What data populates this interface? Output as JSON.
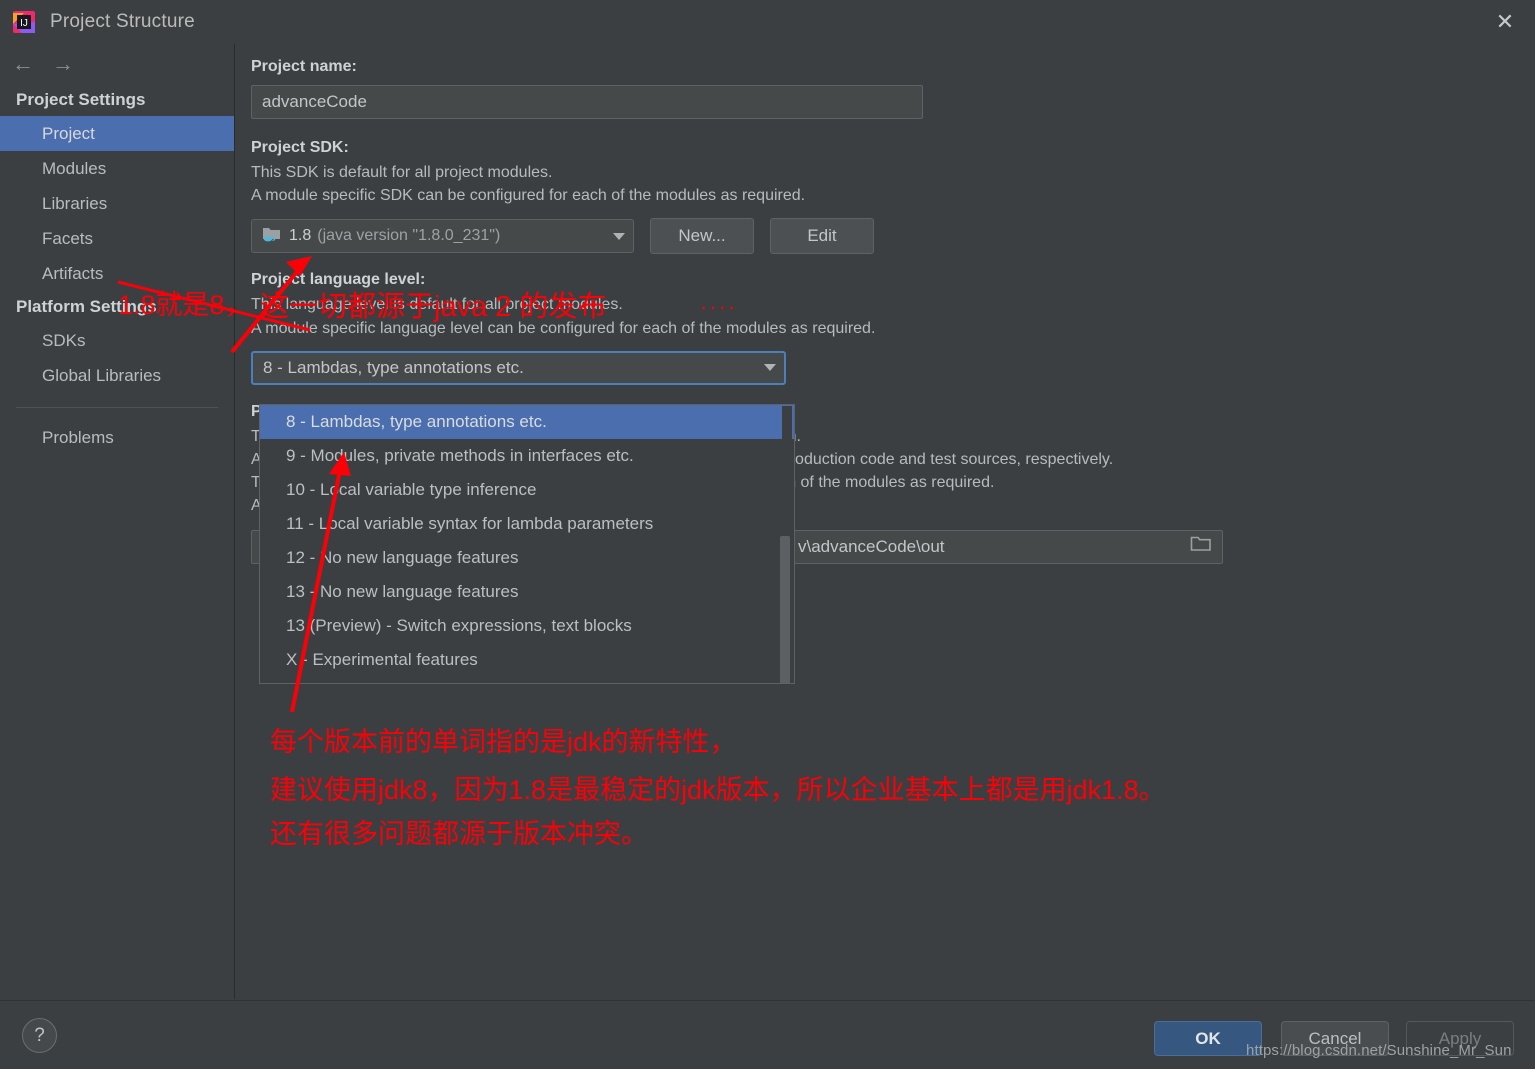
{
  "window": {
    "title": "Project Structure",
    "app_icon": "intellij-idea-icon",
    "close_icon": "close-icon"
  },
  "sidebar": {
    "back_icon": "arrow-left-icon",
    "forward_icon": "arrow-right-icon",
    "groups": [
      {
        "header": "Project Settings",
        "items": [
          {
            "label": "Project",
            "selected": true
          },
          {
            "label": "Modules",
            "selected": false
          },
          {
            "label": "Libraries",
            "selected": false
          },
          {
            "label": "Facets",
            "selected": false
          },
          {
            "label": "Artifacts",
            "selected": false
          }
        ]
      },
      {
        "header": "Platform Settings",
        "items": [
          {
            "label": "SDKs",
            "selected": false
          },
          {
            "label": "Global Libraries",
            "selected": false
          }
        ]
      }
    ],
    "problems_label": "Problems"
  },
  "main": {
    "project_name": {
      "label": "Project name:",
      "value": "advanceCode"
    },
    "project_sdk": {
      "label": "Project SDK:",
      "desc_line1": "This SDK is default for all project modules.",
      "desc_line2": "A module specific SDK can be configured for each of the modules as required.",
      "sdk_icon": "java-folder-icon",
      "selected_name": "1.8",
      "selected_detail": "(java version \"1.8.0_231\")",
      "caret_icon": "chevron-down-icon",
      "new_button": "New...",
      "edit_button": "Edit"
    },
    "project_language_level": {
      "label": "Project language level:",
      "desc_line1": "This language level is default for all project modules.",
      "desc_line2": "A module specific language level can be configured for each of the modules as required.",
      "selected_value": "8 - Lambdas, type annotations etc.",
      "caret_icon": "chevron-down-icon",
      "options": [
        "8 - Lambdas, type annotations etc.",
        "9 - Modules, private methods in interfaces etc.",
        "10 - Local variable type inference",
        "11 - Local variable syntax for lambda parameters",
        "12 - No new language features",
        "13 - No new language features",
        "13 (Preview) - Switch expressions, text blocks",
        "X - Experimental features"
      ],
      "selected_index": 0
    },
    "project_compiler_output": {
      "label": "Project compiler output:",
      "desc_line1_head": "T",
      "desc_line1_tail": "path.",
      "desc_line2_head": "A",
      "desc_line2_tail": "for production code and test sources, respectively.",
      "desc_line3_head": "T",
      "desc_line4_head": "A",
      "desc_line3_tail": "each of the modules as required.",
      "path_value": "v\\advanceCode\\out",
      "browse_icon": "folder-open-icon"
    }
  },
  "annotations": {
    "color": "#fb0007",
    "note_sdk": "1.8就是8，",
    "note_java2": "这一切都源于java 2 的发布",
    "note_ellipsis": "····",
    "note_block_line1": "每个版本前的单词指的是jdk的新特性，",
    "note_block_line2": "建议使用jdk8，因为1.8是最稳定的jdk版本，所以企业基本上都是用jdk1.8。",
    "note_block_line3": "还有很多问题都源于版本冲突。"
  },
  "bottom": {
    "help_icon": "help-question-icon",
    "ok_label": "OK",
    "cancel_label": "Cancel",
    "apply_label": "Apply"
  },
  "watermark": "https://blog.csdn.net/Sunshine_Mr_Sun"
}
